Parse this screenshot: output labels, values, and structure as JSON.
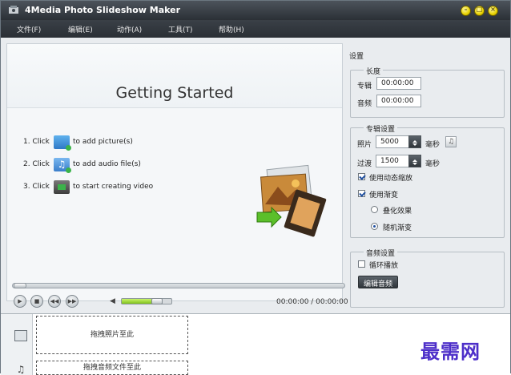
{
  "app": {
    "title": "4Media Photo Slideshow Maker",
    "icon": "app-logo-icon",
    "window_controls": {
      "minimize": "–",
      "maximize": "□",
      "close": "×"
    }
  },
  "menu": {
    "items": [
      {
        "label": "文件(F)"
      },
      {
        "label": "编辑(E)"
      },
      {
        "label": "动作(A)"
      },
      {
        "label": "工具(T)"
      },
      {
        "label": "帮助(H)"
      }
    ]
  },
  "preview": {
    "title": "Getting Started",
    "steps": [
      {
        "prefix": "1. Click",
        "icon": "add-picture-icon",
        "text": "to add picture(s)"
      },
      {
        "prefix": "2. Click",
        "icon": "add-audio-icon",
        "text": "to add audio file(s)"
      },
      {
        "prefix": "3. Click",
        "icon": "create-video-icon",
        "text": "to start creating video"
      }
    ],
    "illustration": "photo-to-video-icon"
  },
  "player": {
    "buttons": [
      "play-icon",
      "stop-icon",
      "previous-icon",
      "next-icon"
    ],
    "volume_icon": "volume-icon",
    "volume_level": 0.78,
    "seek_position": 0.0,
    "time": "00:00:00 / 00:00:00"
  },
  "settings": {
    "header": "设置",
    "length": {
      "title": "长度",
      "album_label": "专辑",
      "album_value": "00:00:00",
      "audio_label": "音频",
      "audio_value": "00:00:00"
    },
    "album": {
      "title": "专辑设置",
      "photo_label": "照片",
      "photo_value": "5000",
      "photo_unit": "毫秒",
      "transition_label": "过渡",
      "transition_value": "1500",
      "transition_unit": "毫秒",
      "music_icon": "music-note-icon",
      "dynamic_zoom_label": "使用动态缩放",
      "dynamic_zoom_checked": true,
      "use_fade_label": "使用渐变",
      "use_fade_checked": true,
      "overlay_label": "叠化效果",
      "overlay_selected": false,
      "random_label": "随机渐变",
      "random_selected": true
    },
    "audio": {
      "title": "音频设置",
      "loop_label": "循环播放",
      "loop_checked": false,
      "edit_button": "编辑音频"
    }
  },
  "timeline": {
    "photo_track_icon": "image-track-icon",
    "audio_track_icon": "music-track-icon",
    "photo_drop_text": "拖拽照片至此",
    "audio_drop_text": "拖拽音频文件至此"
  },
  "watermark": "最需网",
  "colors": {
    "titlebar": "#2b3036",
    "menubar": "#2f353a",
    "accent_green": "#7fc11b",
    "watermark": "#4d2fc9"
  }
}
